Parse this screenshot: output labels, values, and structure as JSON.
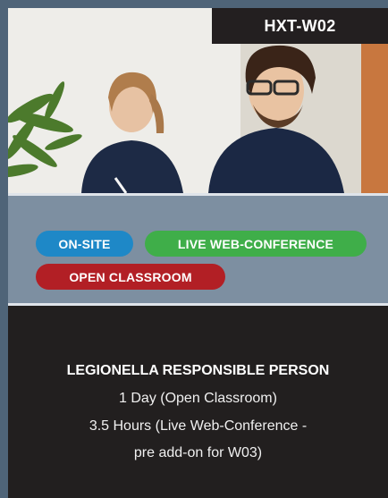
{
  "course": {
    "code": "HXT-W02",
    "title": "LEGIONELLA RESPONSIBLE PERSON",
    "details": [
      "1 Day (Open Classroom)",
      "3.5 Hours (Live Web-Conference -",
      "pre add-on for W03)"
    ]
  },
  "tags": {
    "onsite": "ON-SITE",
    "live": "LIVE WEB-CONFERENCE",
    "classroom": "OPEN CLASSROOM"
  },
  "colors": {
    "page_bg": "#4f6478",
    "card_bg": "#221f1f",
    "tag_panel_bg": "#7d8fa1",
    "onsite": "#1e88c7",
    "live": "#3fae49",
    "classroom": "#b21f25"
  },
  "photo": {
    "subject": "two people seated at a training session, plant in the foreground"
  }
}
